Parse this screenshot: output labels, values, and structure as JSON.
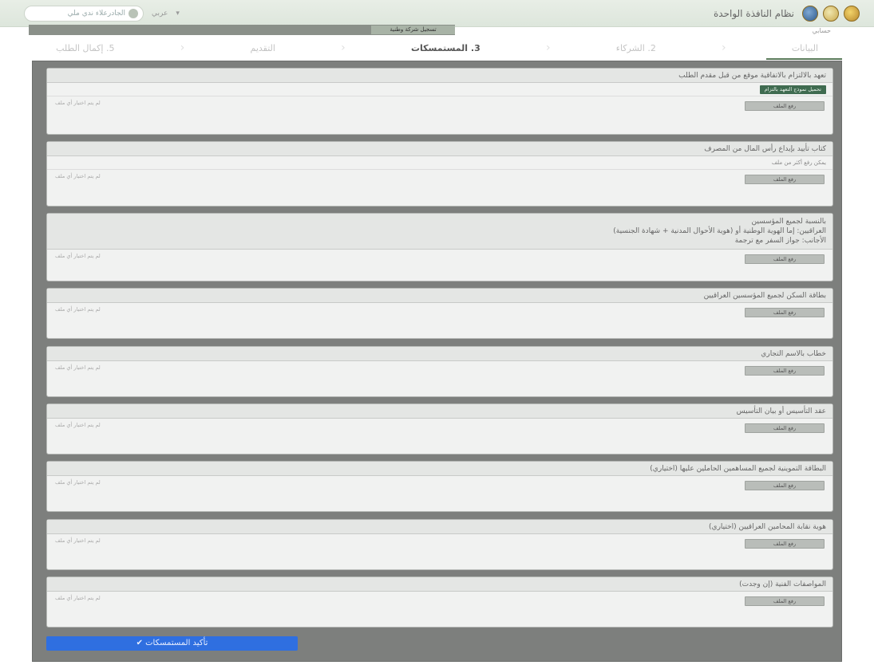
{
  "header": {
    "title": "نظام النافذة الواحدة",
    "user_pill": "الجادرعلاء ندي ملي",
    "language": "عربي",
    "chevron": "▾"
  },
  "subbar": {
    "request_chip": "تسجيل شركة وطنية",
    "right_text": "حسابي"
  },
  "steps": [
    {
      "label": "البيانات"
    },
    {
      "label": "2. الشركاء"
    },
    {
      "label": "3. المستمسكات"
    },
    {
      "label": "التقديم"
    },
    {
      "label": "5. إكمال الطلب"
    }
  ],
  "cards": [
    {
      "title": "تعهد بالالتزام بالاتفاقية موقع من قبل مقدم الطلب",
      "tag": "تحميل نموذج التعهد بالتزام",
      "note": "",
      "upload_label": "رفع الملف",
      "nofile": "لم يتم اختيار أي ملف"
    },
    {
      "title": "كتاب تأييد بإيداع رأس المال من المصرف",
      "tag": "",
      "note": "يمكن رفع أكثر من ملف",
      "upload_label": "رفع الملف",
      "nofile": "لم يتم اختيار أي ملف"
    },
    {
      "title": "بالنسبة لجميع المؤسسين",
      "title2": "العراقيين: إما الهوية الوطنية أو (هوية الأحوال المدنية + شهادة الجنسية)",
      "title3": "الأجانب: جواز السفر مع ترجمة",
      "tag": "",
      "note": "",
      "upload_label": "رفع الملف",
      "nofile": "لم يتم اختيار أي ملف"
    },
    {
      "title": "بطاقة السكن لجميع المؤسسين العراقيين",
      "tag": "",
      "note": "",
      "upload_label": "رفع الملف",
      "nofile": "لم يتم اختيار أي ملف"
    },
    {
      "title": "خطاب بالاسم التجاري",
      "tag": "",
      "note": "",
      "upload_label": "رفع الملف",
      "nofile": "لم يتم اختيار أي ملف"
    },
    {
      "title": "عقد التأسيس أو بيان التأسيس",
      "tag": "",
      "note": "",
      "upload_label": "رفع الملف",
      "nofile": "لم يتم اختيار أي ملف"
    },
    {
      "title": "البطاقة التموينية لجميع المساهمين الحاملين عليها (اختياري)",
      "tag": "",
      "note": "",
      "upload_label": "رفع الملف",
      "nofile": "لم يتم اختيار أي ملف"
    },
    {
      "title": "هوية نقابة المحامين العراقيين (اختياري)",
      "tag": "",
      "note": "",
      "upload_label": "رفع الملف",
      "nofile": "لم يتم اختيار أي ملف"
    },
    {
      "title": "المواصفات الفنية (إن وجدت)",
      "tag": "",
      "note": "",
      "upload_label": "رفع الملف",
      "nofile": "لم يتم اختيار أي ملف"
    }
  ],
  "confirm_button": "✔ تأكيد المستمسكات"
}
